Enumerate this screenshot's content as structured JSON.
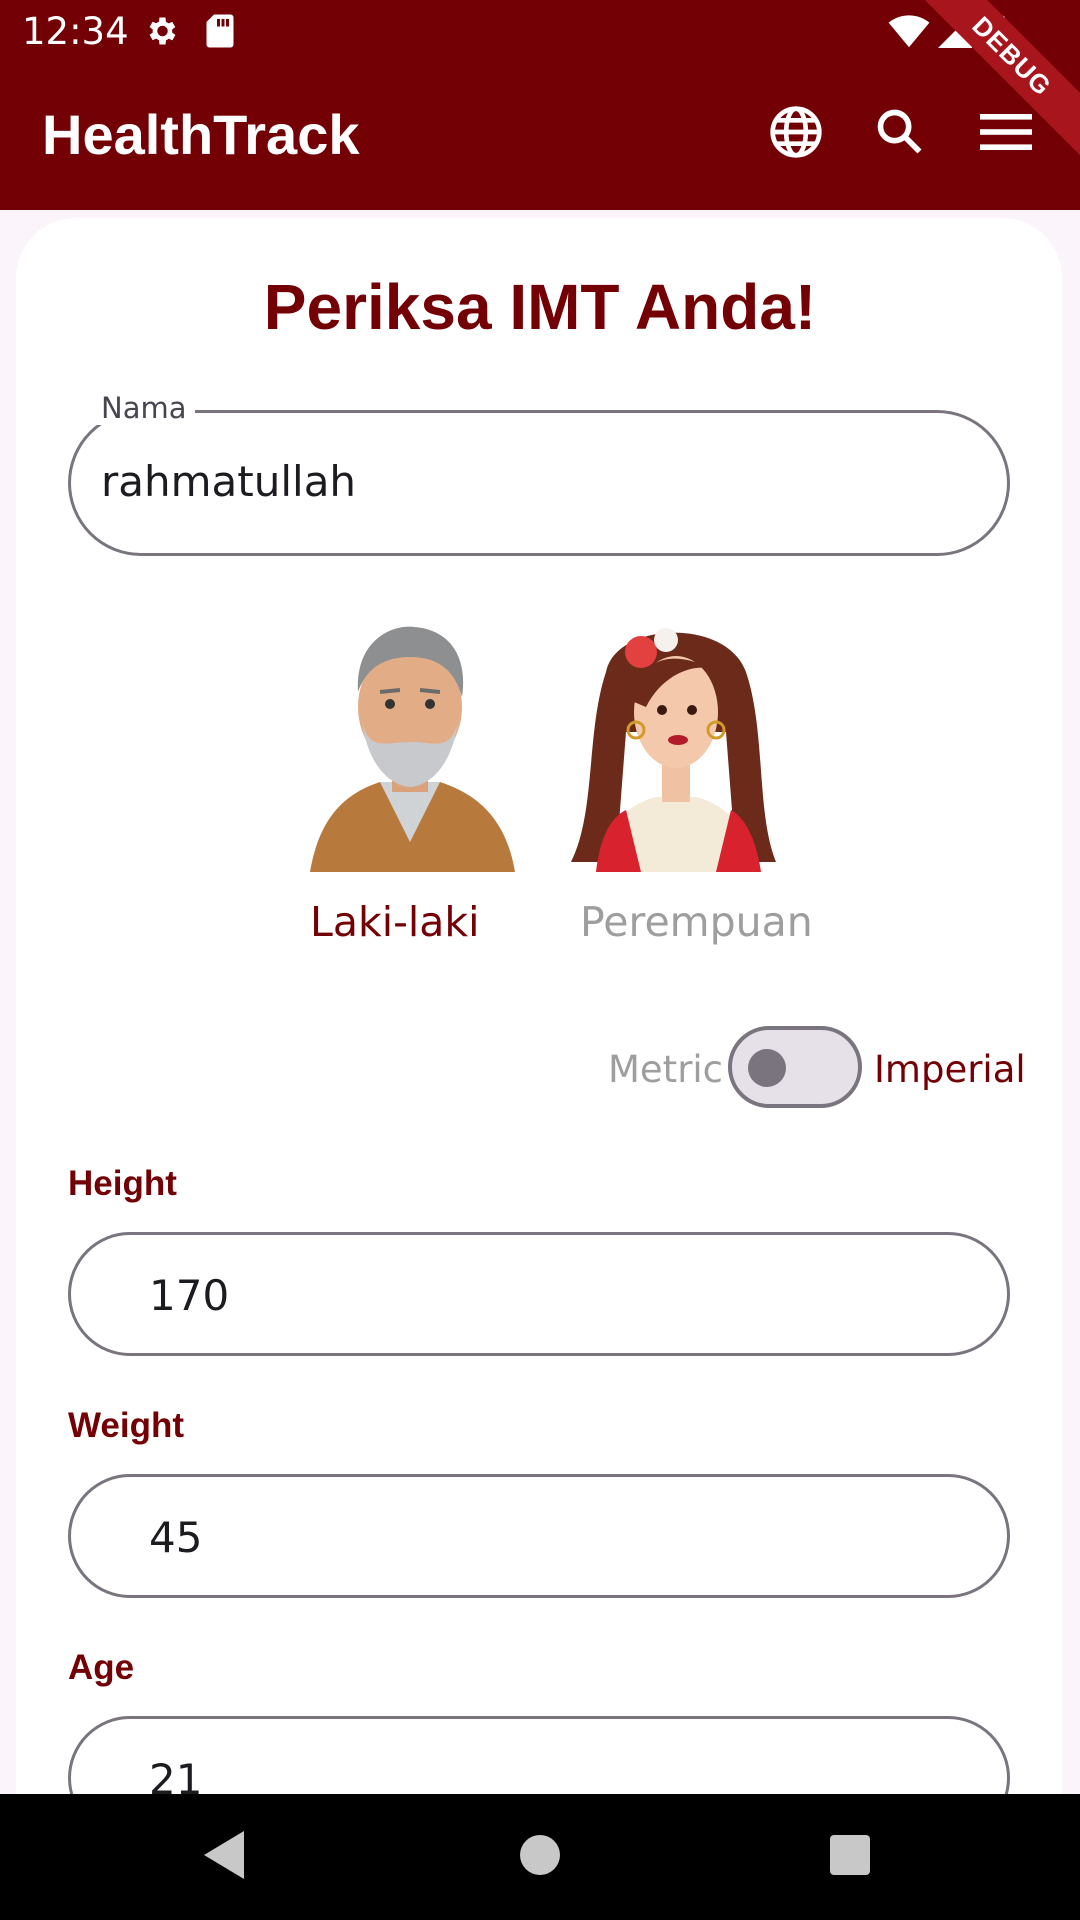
{
  "status": {
    "time": "12:34"
  },
  "appbar": {
    "title": "HealthTrack",
    "debug_banner": "DEBUG"
  },
  "main": {
    "headline": "Periksa IMT Anda!",
    "name_field": {
      "label": "Nama",
      "value": "rahmatullah"
    },
    "gender": {
      "male_label": "Laki-laki",
      "female_label": "Perempuan",
      "selected": "Laki-laki"
    },
    "units": {
      "left": "Metric",
      "right": "Imperial"
    },
    "height": {
      "label": "Height",
      "value": "170"
    },
    "weight": {
      "label": "Weight",
      "value": "45"
    },
    "age": {
      "label": "Age",
      "value": "21"
    }
  },
  "colors": {
    "primary": "#730005",
    "muted_text": "#9e9e9e",
    "outline": "#79747e"
  },
  "icons": {
    "status": [
      "gear-icon",
      "sd-card-icon",
      "wifi-icon",
      "signal-icon",
      "battery-icon"
    ],
    "appbar": [
      "globe-icon",
      "search-icon",
      "menu-icon"
    ],
    "nav": [
      "back-triangle-icon",
      "home-circle-icon",
      "recents-square-icon"
    ]
  }
}
